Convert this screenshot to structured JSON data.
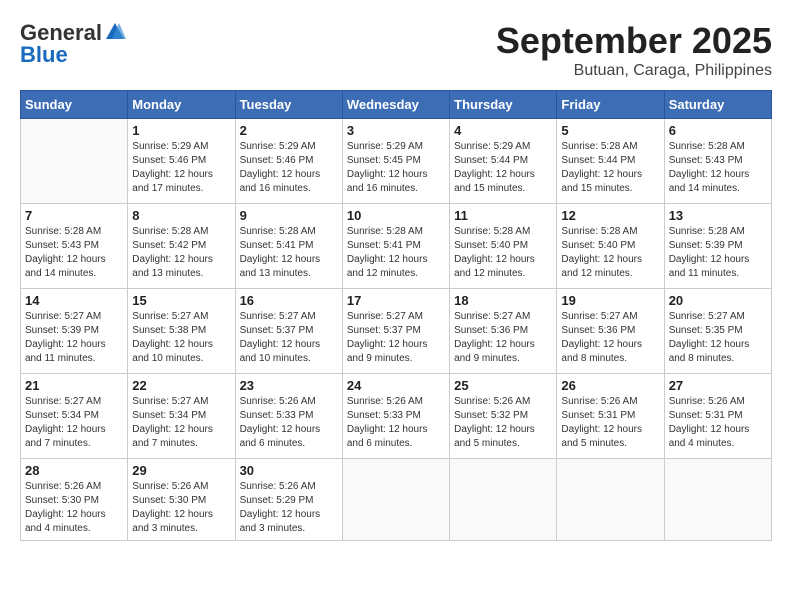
{
  "header": {
    "logo_general": "General",
    "logo_blue": "Blue",
    "month_title": "September 2025",
    "location": "Butuan, Caraga, Philippines"
  },
  "weekdays": [
    "Sunday",
    "Monday",
    "Tuesday",
    "Wednesday",
    "Thursday",
    "Friday",
    "Saturday"
  ],
  "weeks": [
    [
      {
        "day": "",
        "info": ""
      },
      {
        "day": "1",
        "info": "Sunrise: 5:29 AM\nSunset: 5:46 PM\nDaylight: 12 hours\nand 17 minutes."
      },
      {
        "day": "2",
        "info": "Sunrise: 5:29 AM\nSunset: 5:46 PM\nDaylight: 12 hours\nand 16 minutes."
      },
      {
        "day": "3",
        "info": "Sunrise: 5:29 AM\nSunset: 5:45 PM\nDaylight: 12 hours\nand 16 minutes."
      },
      {
        "day": "4",
        "info": "Sunrise: 5:29 AM\nSunset: 5:44 PM\nDaylight: 12 hours\nand 15 minutes."
      },
      {
        "day": "5",
        "info": "Sunrise: 5:28 AM\nSunset: 5:44 PM\nDaylight: 12 hours\nand 15 minutes."
      },
      {
        "day": "6",
        "info": "Sunrise: 5:28 AM\nSunset: 5:43 PM\nDaylight: 12 hours\nand 14 minutes."
      }
    ],
    [
      {
        "day": "7",
        "info": "Sunrise: 5:28 AM\nSunset: 5:43 PM\nDaylight: 12 hours\nand 14 minutes."
      },
      {
        "day": "8",
        "info": "Sunrise: 5:28 AM\nSunset: 5:42 PM\nDaylight: 12 hours\nand 13 minutes."
      },
      {
        "day": "9",
        "info": "Sunrise: 5:28 AM\nSunset: 5:41 PM\nDaylight: 12 hours\nand 13 minutes."
      },
      {
        "day": "10",
        "info": "Sunrise: 5:28 AM\nSunset: 5:41 PM\nDaylight: 12 hours\nand 12 minutes."
      },
      {
        "day": "11",
        "info": "Sunrise: 5:28 AM\nSunset: 5:40 PM\nDaylight: 12 hours\nand 12 minutes."
      },
      {
        "day": "12",
        "info": "Sunrise: 5:28 AM\nSunset: 5:40 PM\nDaylight: 12 hours\nand 12 minutes."
      },
      {
        "day": "13",
        "info": "Sunrise: 5:28 AM\nSunset: 5:39 PM\nDaylight: 12 hours\nand 11 minutes."
      }
    ],
    [
      {
        "day": "14",
        "info": "Sunrise: 5:27 AM\nSunset: 5:39 PM\nDaylight: 12 hours\nand 11 minutes."
      },
      {
        "day": "15",
        "info": "Sunrise: 5:27 AM\nSunset: 5:38 PM\nDaylight: 12 hours\nand 10 minutes."
      },
      {
        "day": "16",
        "info": "Sunrise: 5:27 AM\nSunset: 5:37 PM\nDaylight: 12 hours\nand 10 minutes."
      },
      {
        "day": "17",
        "info": "Sunrise: 5:27 AM\nSunset: 5:37 PM\nDaylight: 12 hours\nand 9 minutes."
      },
      {
        "day": "18",
        "info": "Sunrise: 5:27 AM\nSunset: 5:36 PM\nDaylight: 12 hours\nand 9 minutes."
      },
      {
        "day": "19",
        "info": "Sunrise: 5:27 AM\nSunset: 5:36 PM\nDaylight: 12 hours\nand 8 minutes."
      },
      {
        "day": "20",
        "info": "Sunrise: 5:27 AM\nSunset: 5:35 PM\nDaylight: 12 hours\nand 8 minutes."
      }
    ],
    [
      {
        "day": "21",
        "info": "Sunrise: 5:27 AM\nSunset: 5:34 PM\nDaylight: 12 hours\nand 7 minutes."
      },
      {
        "day": "22",
        "info": "Sunrise: 5:27 AM\nSunset: 5:34 PM\nDaylight: 12 hours\nand 7 minutes."
      },
      {
        "day": "23",
        "info": "Sunrise: 5:26 AM\nSunset: 5:33 PM\nDaylight: 12 hours\nand 6 minutes."
      },
      {
        "day": "24",
        "info": "Sunrise: 5:26 AM\nSunset: 5:33 PM\nDaylight: 12 hours\nand 6 minutes."
      },
      {
        "day": "25",
        "info": "Sunrise: 5:26 AM\nSunset: 5:32 PM\nDaylight: 12 hours\nand 5 minutes."
      },
      {
        "day": "26",
        "info": "Sunrise: 5:26 AM\nSunset: 5:31 PM\nDaylight: 12 hours\nand 5 minutes."
      },
      {
        "day": "27",
        "info": "Sunrise: 5:26 AM\nSunset: 5:31 PM\nDaylight: 12 hours\nand 4 minutes."
      }
    ],
    [
      {
        "day": "28",
        "info": "Sunrise: 5:26 AM\nSunset: 5:30 PM\nDaylight: 12 hours\nand 4 minutes."
      },
      {
        "day": "29",
        "info": "Sunrise: 5:26 AM\nSunset: 5:30 PM\nDaylight: 12 hours\nand 3 minutes."
      },
      {
        "day": "30",
        "info": "Sunrise: 5:26 AM\nSunset: 5:29 PM\nDaylight: 12 hours\nand 3 minutes."
      },
      {
        "day": "",
        "info": ""
      },
      {
        "day": "",
        "info": ""
      },
      {
        "day": "",
        "info": ""
      },
      {
        "day": "",
        "info": ""
      }
    ]
  ]
}
